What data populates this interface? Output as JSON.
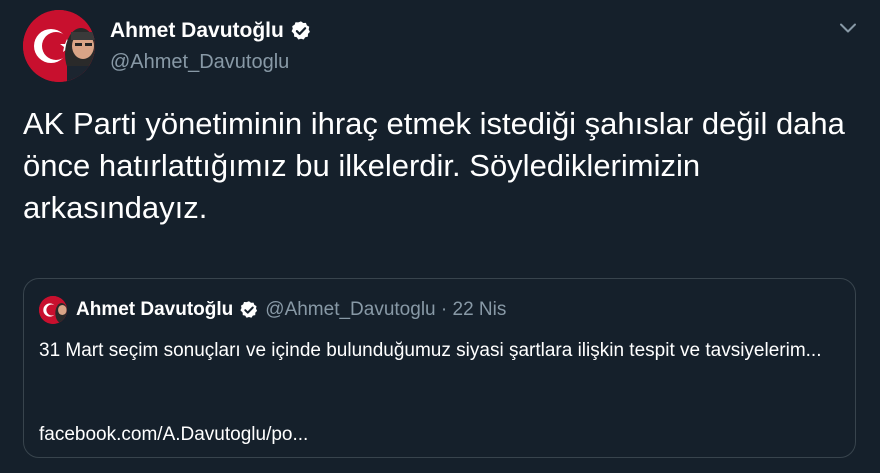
{
  "author": {
    "name": "Ahmet Davutoğlu",
    "handle": "@Ahmet_Davutoglu"
  },
  "tweet": {
    "text": "AK Parti yönetiminin ihraç etmek istediği şahıslar değil daha önce hatırlattığımız bu ilkelerdir. Söylediklerimizin arkasındayız."
  },
  "quoted_tweet": {
    "name": "Ahmet Davutoğlu",
    "handle": "@Ahmet_Davutoglu",
    "separator": " · ",
    "date": "22 Nis",
    "text": "31 Mart seçim sonuçları ve içinde bulunduğumuz siyasi şartlara ilişkin tespit ve tavsiyelerim...",
    "link": "facebook.com/A.Davutoglu/po..."
  },
  "icons": {
    "verified": "verified-badge-icon",
    "caret": "chevron-down-icon"
  },
  "colors": {
    "background": "#15202b",
    "text_primary": "#ffffff",
    "text_secondary": "#8899a6",
    "border": "#38444d",
    "verified_badge": "#ffffff",
    "flag_red": "#c8102e"
  }
}
